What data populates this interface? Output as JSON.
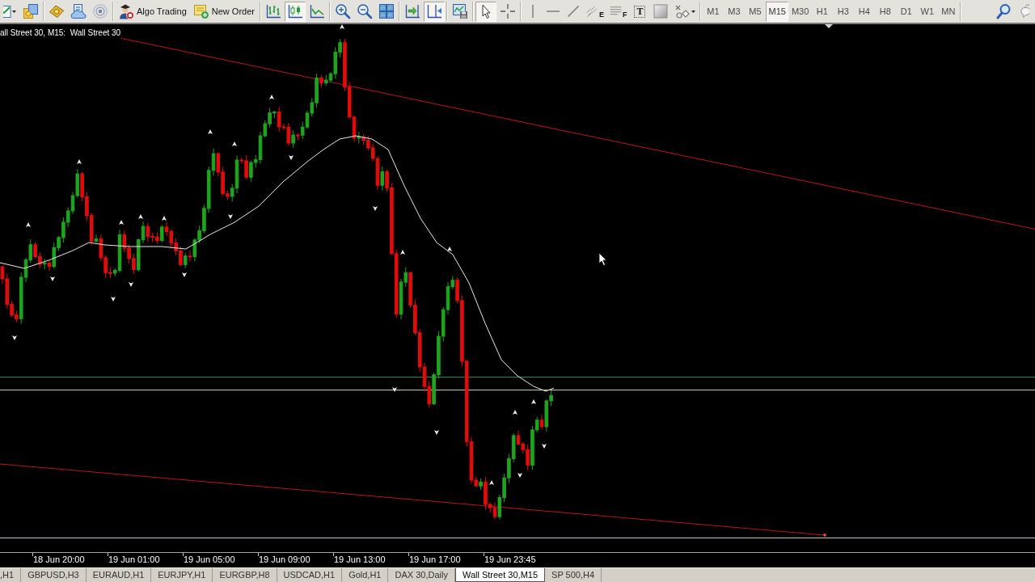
{
  "toolbar": {
    "groups": [
      {
        "buttons": [
          {
            "pressed": false
          },
          {
            "pressed": false
          }
        ]
      },
      {
        "buttons": [
          {
            "pressed": false
          },
          {
            "pressed": false
          },
          {
            "pressed": false
          }
        ]
      },
      {
        "buttons": [
          {
            "label": "Algo Trading",
            "pressed": false
          },
          {
            "label": "New Order",
            "pressed": false
          }
        ]
      },
      {
        "buttons": [
          {
            "pressed": false
          },
          {
            "pressed": true
          },
          {
            "pressed": false
          }
        ]
      },
      {
        "buttons": [
          {
            "pressed": false
          },
          {
            "pressed": false
          },
          {
            "pressed": false
          }
        ]
      },
      {
        "buttons": [
          {
            "pressed": false
          },
          {
            "pressed": true
          }
        ]
      },
      {
        "buttons": [
          {
            "pressed": false
          }
        ]
      },
      {
        "buttons": [
          {
            "pressed": true
          },
          {
            "pressed": false
          }
        ]
      },
      {
        "buttons": [
          {
            "pressed": false
          },
          {
            "pressed": false
          },
          {
            "pressed": false
          },
          {
            "glyph": "E",
            "pressed": false
          },
          {
            "glyph": "F",
            "pressed": false
          },
          {
            "glyph": "T",
            "pressed": false
          },
          {
            "pressed": false
          },
          {
            "pressed": false
          }
        ]
      }
    ],
    "timeframes": [
      {
        "label": "M1",
        "selected": false
      },
      {
        "label": "M3",
        "selected": false
      },
      {
        "label": "M5",
        "selected": false
      },
      {
        "label": "M15",
        "selected": true
      },
      {
        "label": "M30",
        "selected": false
      },
      {
        "label": "H1",
        "selected": false
      },
      {
        "label": "H3",
        "selected": false
      },
      {
        "label": "H4",
        "selected": false
      },
      {
        "label": "H8",
        "selected": false
      },
      {
        "label": "D1",
        "selected": false
      },
      {
        "label": "W1",
        "selected": false
      },
      {
        "label": "MN",
        "selected": false
      }
    ],
    "right_buttons": [
      {
        "pressed": false
      },
      {
        "pressed": false
      }
    ]
  },
  "chart": {
    "title": "all Street 30, M15:  Wall Street 30",
    "time_axis": [
      "18 Jun 20:00",
      "19 Jun 01:00",
      "19 Jun 05:00",
      "19 Jun 09:00",
      "19 Jun 13:00",
      "19 Jun 17:00",
      "19 Jun 23:45"
    ]
  },
  "tabs": [
    {
      "label": ",H1",
      "selected": false
    },
    {
      "label": "GBPUSD,H3",
      "selected": false
    },
    {
      "label": "EURAUD,H1",
      "selected": false
    },
    {
      "label": "EURJPY,H1",
      "selected": false
    },
    {
      "label": "EURGBP,H8",
      "selected": false
    },
    {
      "label": "USDCAD,H1",
      "selected": false
    },
    {
      "label": "Gold,H1",
      "selected": false
    },
    {
      "label": "DAX 30,Daily",
      "selected": false
    },
    {
      "label": "Wall Street 30,M15",
      "selected": true
    },
    {
      "label": "SP 500,H4",
      "selected": false
    }
  ]
}
